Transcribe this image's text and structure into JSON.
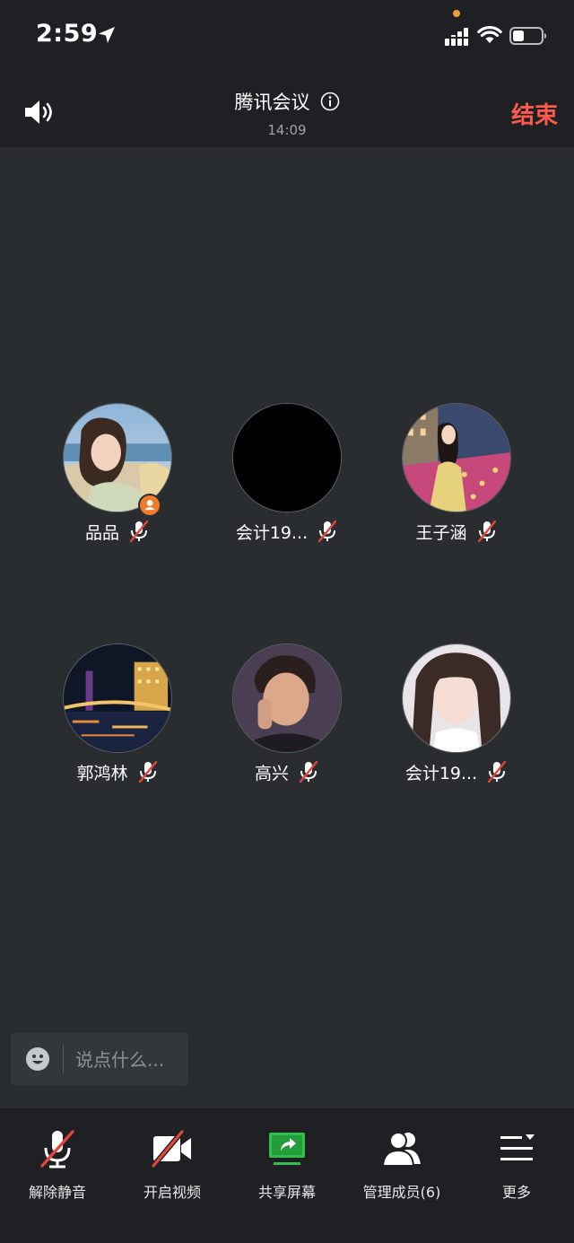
{
  "status_bar": {
    "time": "2:59"
  },
  "header": {
    "title": "腾讯会议",
    "duration": "14:09",
    "end_label": "结束"
  },
  "participants": [
    {
      "name": "品品",
      "muted": true,
      "host": true
    },
    {
      "name": "会计19...",
      "muted": true,
      "host": false
    },
    {
      "name": "王子涵",
      "muted": true,
      "host": false
    },
    {
      "name": "郭鸿林",
      "muted": true,
      "host": false
    },
    {
      "name": "高兴",
      "muted": true,
      "host": false
    },
    {
      "name": "会计19...",
      "muted": true,
      "host": false
    }
  ],
  "chat": {
    "placeholder": "说点什么..."
  },
  "toolbar": {
    "items": [
      {
        "label": "解除静音",
        "icon": "mic-muted-icon"
      },
      {
        "label": "开启视频",
        "icon": "video-off-icon"
      },
      {
        "label": "共享屏幕",
        "icon": "share-screen-icon"
      },
      {
        "label": "管理成员(6)",
        "icon": "members-icon"
      },
      {
        "label": "更多",
        "icon": "more-icon"
      }
    ]
  },
  "colors": {
    "end": "#ff5a4e",
    "share": "#2fbf4a",
    "host_badge": "#f07b2c",
    "mute_slash": "#e2453a"
  }
}
